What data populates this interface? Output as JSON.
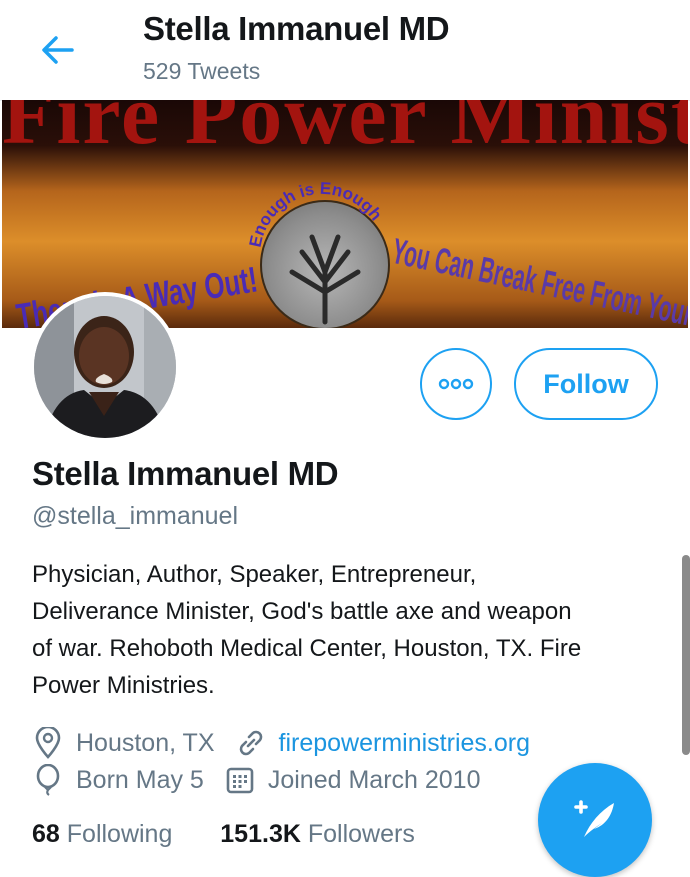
{
  "header": {
    "title": "Stella Immanuel MD",
    "tweet_count": "529 Tweets"
  },
  "banner": {
    "top_text": "Fire Power Ministries",
    "left_text": "There is A Way Out!",
    "arc_text": "Enough is Enough",
    "right_text": "You Can Break Free From Your Past!"
  },
  "profile": {
    "name": "Stella Immanuel MD",
    "handle": "@stella_immanuel",
    "bio": "Physician, Author, Speaker, Entrepreneur, Deliverance Minister, God's battle axe and weapon of war. Rehoboth Medical Center, Houston, TX. Fire Power Ministries.",
    "location": "Houston, TX",
    "website": "firepowerministries.org",
    "birthday": "Born May 5",
    "joined": "Joined March 2010"
  },
  "actions": {
    "follow_label": "Follow"
  },
  "counts": {
    "following_num": "68",
    "following_label": "Following",
    "followers_num": "151.3K",
    "followers_label": "Followers"
  },
  "colors": {
    "accent": "#1da1f2",
    "muted": "#657786",
    "text": "#14171a"
  },
  "icons": [
    "back-arrow-icon",
    "more-icon",
    "location-pin-icon",
    "link-icon",
    "balloon-icon",
    "calendar-icon",
    "compose-tweet-icon"
  ]
}
